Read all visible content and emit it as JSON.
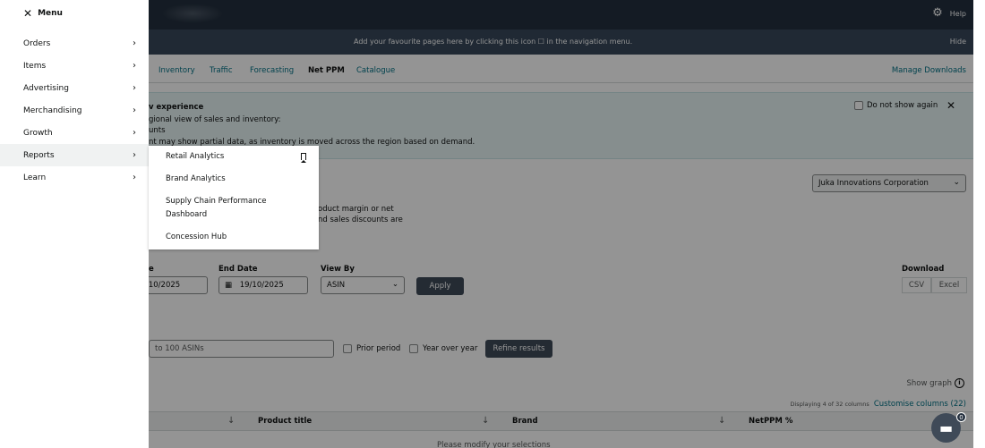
{
  "menu": {
    "title": "Menu",
    "items": [
      {
        "label": "Orders"
      },
      {
        "label": "Items"
      },
      {
        "label": "Advertising"
      },
      {
        "label": "Merchandising"
      },
      {
        "label": "Growth"
      },
      {
        "label": "Reports"
      },
      {
        "label": "Learn"
      }
    ]
  },
  "submenu": {
    "items": [
      {
        "label": "Retail Analytics"
      },
      {
        "label": "Brand Analytics"
      },
      {
        "label": "Supply Chain Performance"
      },
      {
        "label": "Dashboard"
      },
      {
        "label": "Concession Hub"
      }
    ]
  },
  "header": {
    "help_label": "Help",
    "favourites_text": "Add your favourite pages here by clicking this icon ☐ in the navigation menu.",
    "hide_label": "Hide"
  },
  "tabs": [
    {
      "label": "Inventory"
    },
    {
      "label": "Traffic"
    },
    {
      "label": "Forecasting"
    },
    {
      "label": "Net PPM"
    },
    {
      "label": "Catalogue"
    }
  ],
  "manage_downloads": "Manage Downloads",
  "banner": {
    "title": "v experience",
    "line1": "gional view of sales and inventory:",
    "line2": "unts",
    "line3": "nt may show partial data, as inventory is moved across the region based on demand.",
    "dont_show": "Do not show again"
  },
  "company_select": "Juka Innovations Corporation",
  "description": {
    "line1": "oduct margin or net",
    "line2": "nd sales discounts are"
  },
  "filters": {
    "start_label": "e",
    "start_value": "/10/2025",
    "end_label": "End Date",
    "end_value": "19/10/2025",
    "viewby_label": "View By",
    "viewby_value": "ASIN",
    "apply_label": "Apply",
    "download_label": "Download",
    "csv_label": "CSV",
    "excel_label": "Excel"
  },
  "refine": {
    "asin_placeholder": "to 100 ASINs",
    "prior_period": "Prior period",
    "year_over_year": "Year over year",
    "refine_label": "Refine results"
  },
  "table": {
    "show_graph": "Show graph",
    "columns_info": "Displaying 4 of 32 columns",
    "customise": "Customise columns (22)",
    "headers": [
      "Product title",
      "Brand",
      "NetPPM %"
    ],
    "empty_text": "Please modify your selections"
  },
  "chat": {
    "badge": "0"
  }
}
